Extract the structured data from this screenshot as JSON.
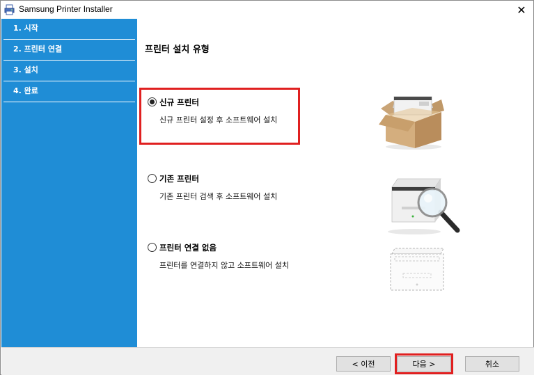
{
  "window": {
    "title": "Samsung Printer Installer",
    "close_glyph": "✕"
  },
  "sidebar": {
    "steps": [
      {
        "label": "1. 시작"
      },
      {
        "label": "2. 프린터 연결"
      },
      {
        "label": "3. 설치"
      },
      {
        "label": "4. 완료"
      }
    ]
  },
  "main": {
    "title": "프린터 설치 유형",
    "options": [
      {
        "label": "신규 프린터",
        "description": "신규 프린터 설정 후 소프트웨어 설치",
        "selected": true,
        "icon": "printer-in-box-icon"
      },
      {
        "label": "기존 프린터",
        "description": "기존 프린터 검색 후 소프트웨어 설치",
        "selected": false,
        "icon": "printer-search-icon"
      },
      {
        "label": "프린터 연결 없음",
        "description": "프린터를 연결하지 않고 소프트웨어 설치",
        "selected": false,
        "icon": "printer-outline-icon"
      }
    ]
  },
  "footer": {
    "back_label": "< 이전",
    "next_label": "다음 >",
    "cancel_label": "취소"
  },
  "colors": {
    "sidebar": "#1f8dd6",
    "highlight": "#e02020"
  }
}
